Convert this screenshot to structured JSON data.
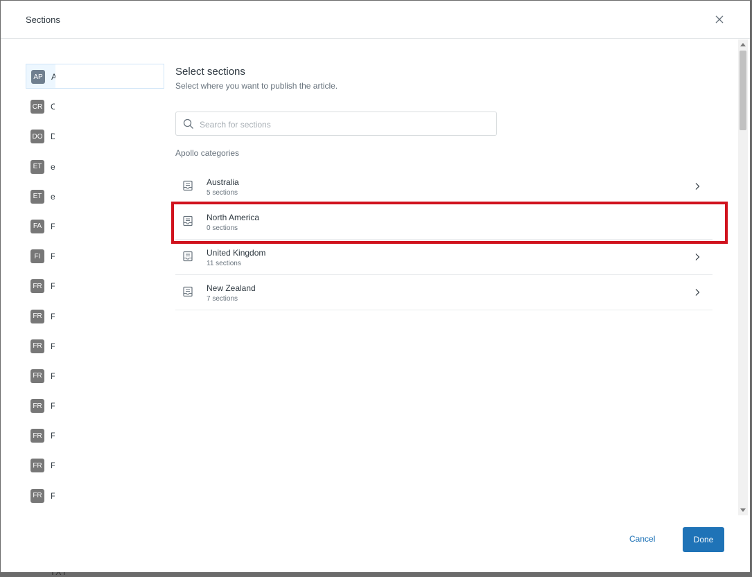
{
  "backdrop": {
    "text": "TXT"
  },
  "dialog": {
    "title": "Sections",
    "close_icon": "close-icon"
  },
  "left_list": [
    {
      "abbr": "AP",
      "label": "A",
      "active": true
    },
    {
      "abbr": "CR",
      "label": "C"
    },
    {
      "abbr": "DO",
      "label": "D"
    },
    {
      "abbr": "ET",
      "label": "e"
    },
    {
      "abbr": "ET",
      "label": "e"
    },
    {
      "abbr": "FA",
      "label": "F"
    },
    {
      "abbr": "FI",
      "label": "Fi"
    },
    {
      "abbr": "FR",
      "label": "F"
    },
    {
      "abbr": "FR",
      "label": "F"
    },
    {
      "abbr": "FR",
      "label": "F"
    },
    {
      "abbr": "FR",
      "label": "F"
    },
    {
      "abbr": "FR",
      "label": "F"
    },
    {
      "abbr": "FR",
      "label": "Fi"
    },
    {
      "abbr": "FR",
      "label": "F"
    },
    {
      "abbr": "FR",
      "label": "F"
    }
  ],
  "main": {
    "title": "Select sections",
    "subtitle": "Select where you want to publish the article.",
    "search": {
      "placeholder": "Search for sections",
      "value": ""
    },
    "group_label": "Apollo categories",
    "categories": [
      {
        "name": "Australia",
        "count": "5 sections",
        "has_children": true
      },
      {
        "name": "North America",
        "count": "0 sections",
        "has_children": false
      },
      {
        "name": "United Kingdom",
        "count": "11 sections",
        "has_children": true
      },
      {
        "name": "New Zealand",
        "count": "7 sections",
        "has_children": true
      }
    ]
  },
  "footer": {
    "cancel_label": "Cancel",
    "done_label": "Done"
  },
  "colors": {
    "accent": "#1f73b7",
    "highlight": "#d0121d"
  }
}
